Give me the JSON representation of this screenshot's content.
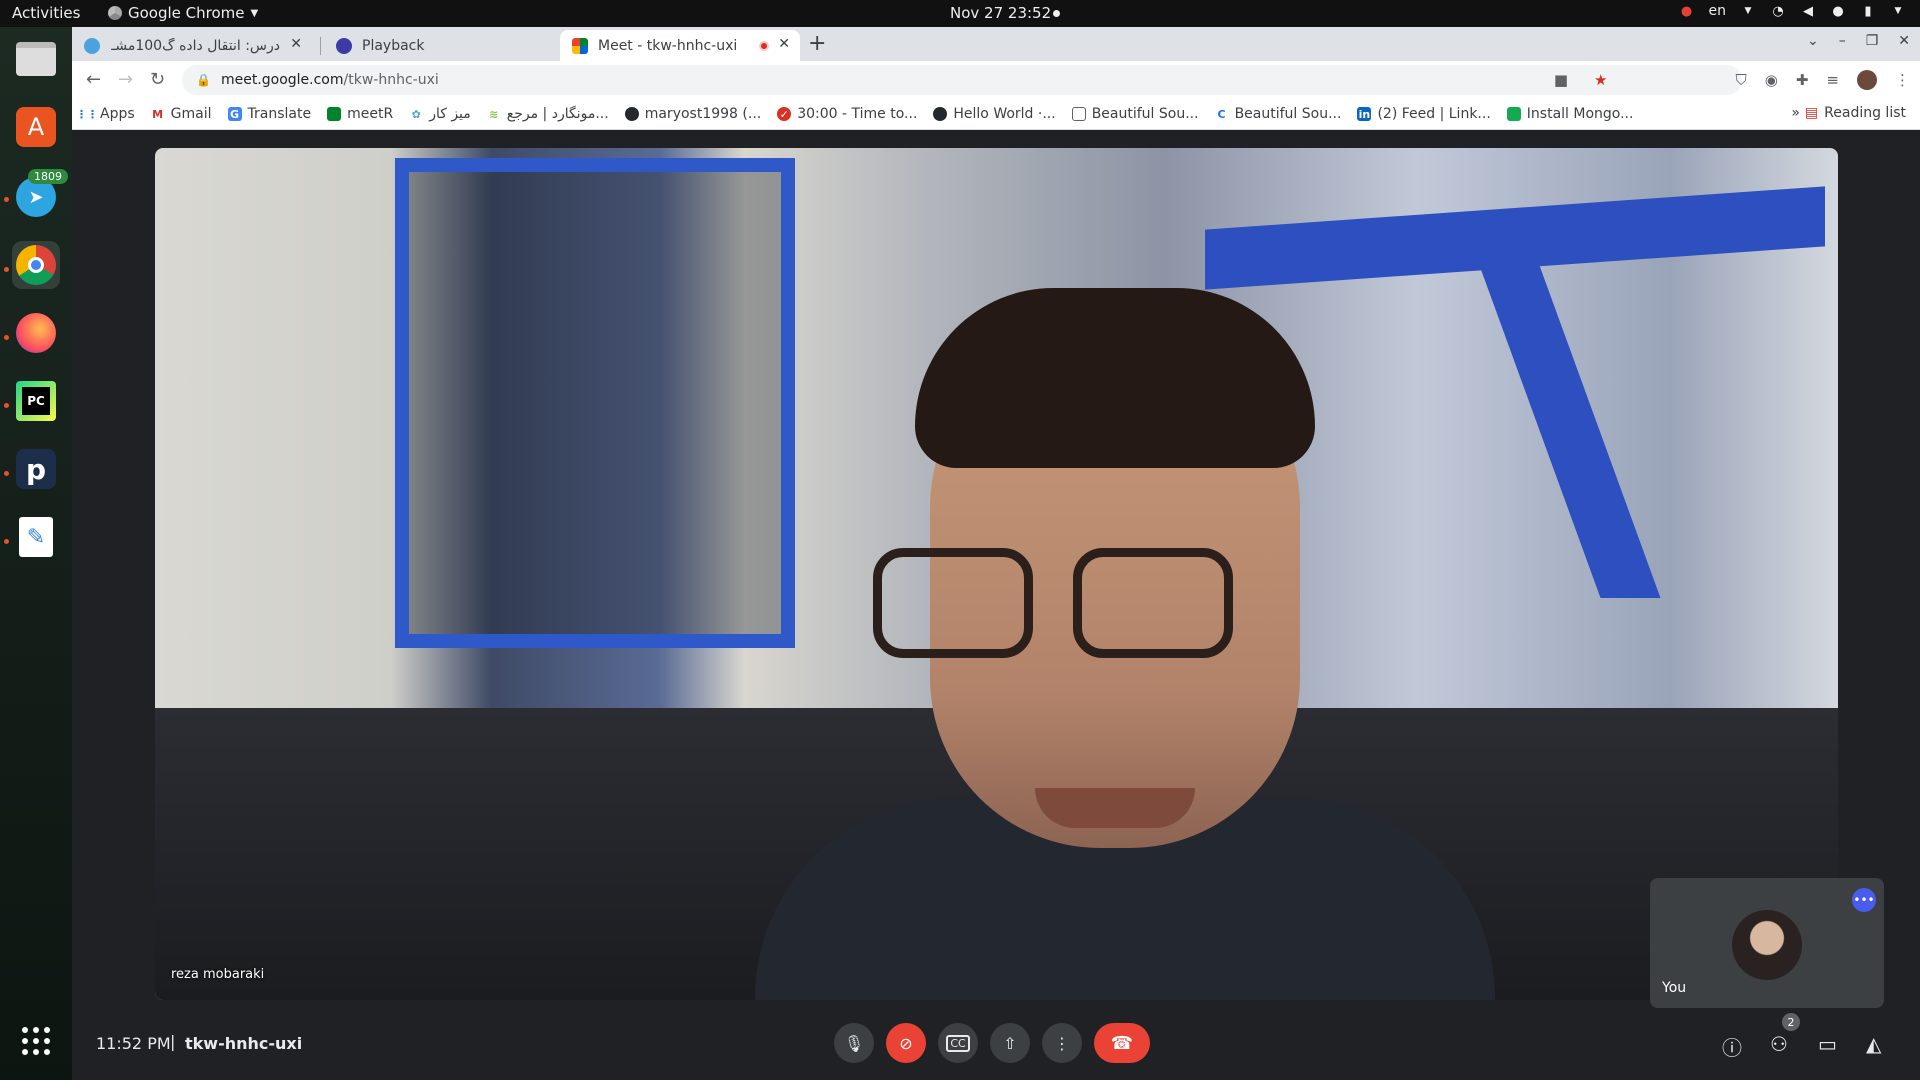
{
  "topbar": {
    "activities": "Activities",
    "app_name": "Google Chrome",
    "clock": "Nov 27  23:52",
    "language": "en"
  },
  "dock": {
    "telegram_badge": "1809"
  },
  "tabs": [
    {
      "title": "درس: انتقال داده گ100مشـ"
    },
    {
      "title": "Playback"
    },
    {
      "title": "Meet - tkw-hnhc-uxi"
    }
  ],
  "omnibox": {
    "host": "meet.google.com",
    "path": "/tkw-hnhc-uxi"
  },
  "bookmarks": [
    {
      "label": "Apps"
    },
    {
      "label": "Gmail"
    },
    {
      "label": "Translate"
    },
    {
      "label": "meetR"
    },
    {
      "label": "میز کار"
    },
    {
      "label": "مونگارد | مرجع..."
    },
    {
      "label": "maryost1998 (..."
    },
    {
      "label": "30:00 - Time to..."
    },
    {
      "label": "Hello World ·..."
    },
    {
      "label": "Beautiful Sou..."
    },
    {
      "label": "Beautiful Sou..."
    },
    {
      "label": "(2) Feed | Link..."
    },
    {
      "label": "Install Mongo..."
    }
  ],
  "bookmarks_more": "»",
  "reading_list": "Reading list",
  "meet": {
    "speaker_name": "reza mobaraki",
    "self_label": "You",
    "time": "11:52 PM",
    "separator": "|",
    "meeting_code": "tkw-hnhc-uxi",
    "participant_count": "2"
  },
  "colors": {
    "end_call": "#ea4335",
    "accent": "#4a5cf0"
  }
}
